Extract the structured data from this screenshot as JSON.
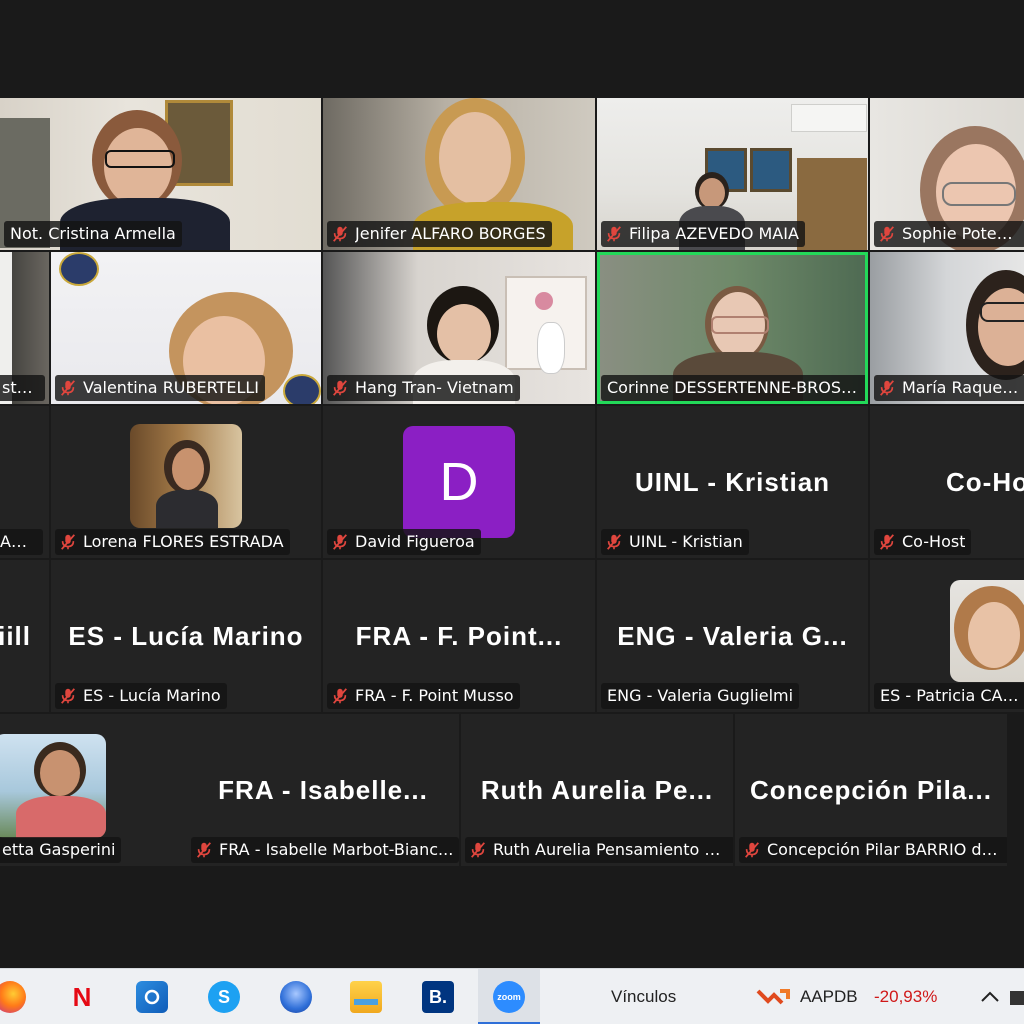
{
  "participants": {
    "row1": [
      {
        "name": "Not. Cristina Armella",
        "muted": false
      },
      {
        "name": "Jenifer ALFARO BORGES",
        "muted": true
      },
      {
        "name": "Filipa AZEVEDO MAIA",
        "muted": true
      },
      {
        "name": "Sophie Potentie",
        "muted": true
      }
    ],
    "row2": [
      {
        "name": "stratif",
        "muted": false
      },
      {
        "name": "Valentina RUBERTELLI",
        "muted": true
      },
      {
        "name": "Hang Tran- Vietnam",
        "muted": true
      },
      {
        "name": "Corinne DESSERTENNE-BROSS...",
        "muted": false,
        "speaking": true
      },
      {
        "name": "María Raquel B",
        "muted": true
      }
    ],
    "row3": [
      {
        "name": "ANZA",
        "muted": false
      },
      {
        "name": "Lorena FLORES ESTRADA",
        "muted": true
      },
      {
        "name": "David Figueroa",
        "muted": true,
        "initial": "D",
        "avatar_color": "#8b1fc4"
      },
      {
        "name": "UINL - Kristian",
        "muted": true,
        "display": "UINL - Kristian"
      },
      {
        "name": "Co-Host",
        "muted": true,
        "display": "Co-Ho"
      }
    ],
    "row4": [
      {
        "display": "iill"
      },
      {
        "name": "ES - Lucía Marino",
        "muted": true,
        "display": "ES - Lucía Marino"
      },
      {
        "name": "FRA - F. Point Musso",
        "muted": true,
        "display": "FRA - F. Point..."
      },
      {
        "name": "ENG - Valeria Guglielmi",
        "muted": false,
        "display": "ENG - Valeria G..."
      },
      {
        "name": "ES - Patricia CASH",
        "muted": false
      }
    ],
    "row5": [
      {
        "name": "etta Gasperini",
        "muted": false
      },
      {
        "name": "FRA - Isabelle Marbot-Bianc...",
        "muted": true,
        "display": "FRA - Isabelle..."
      },
      {
        "name": "Ruth Aurelia Pensamiento M...",
        "muted": true,
        "display": "Ruth Aurelia Pe..."
      },
      {
        "name": "Concepción Pilar BARRIO de...",
        "muted": true,
        "display": "Concepción Pila..."
      }
    ]
  },
  "taskbar": {
    "apps": [
      "firefox-icon",
      "netflix-icon",
      "outlook-icon",
      "skype-icon",
      "thunderbird-icon",
      "file-explorer-icon",
      "booking-icon",
      "zoom-icon"
    ],
    "netflix_letter": "N",
    "skype_letter": "S",
    "booking_letter": "B.",
    "zoom_label": "zoom",
    "links_label": "Vínculos",
    "stock_symbol": "AAPDB",
    "stock_change": "-20,93%",
    "stock_color": "#d01818"
  },
  "colors": {
    "speaking_border": "#23d959",
    "muted_icon": "#e0463e",
    "background": "#1a1a1a"
  }
}
